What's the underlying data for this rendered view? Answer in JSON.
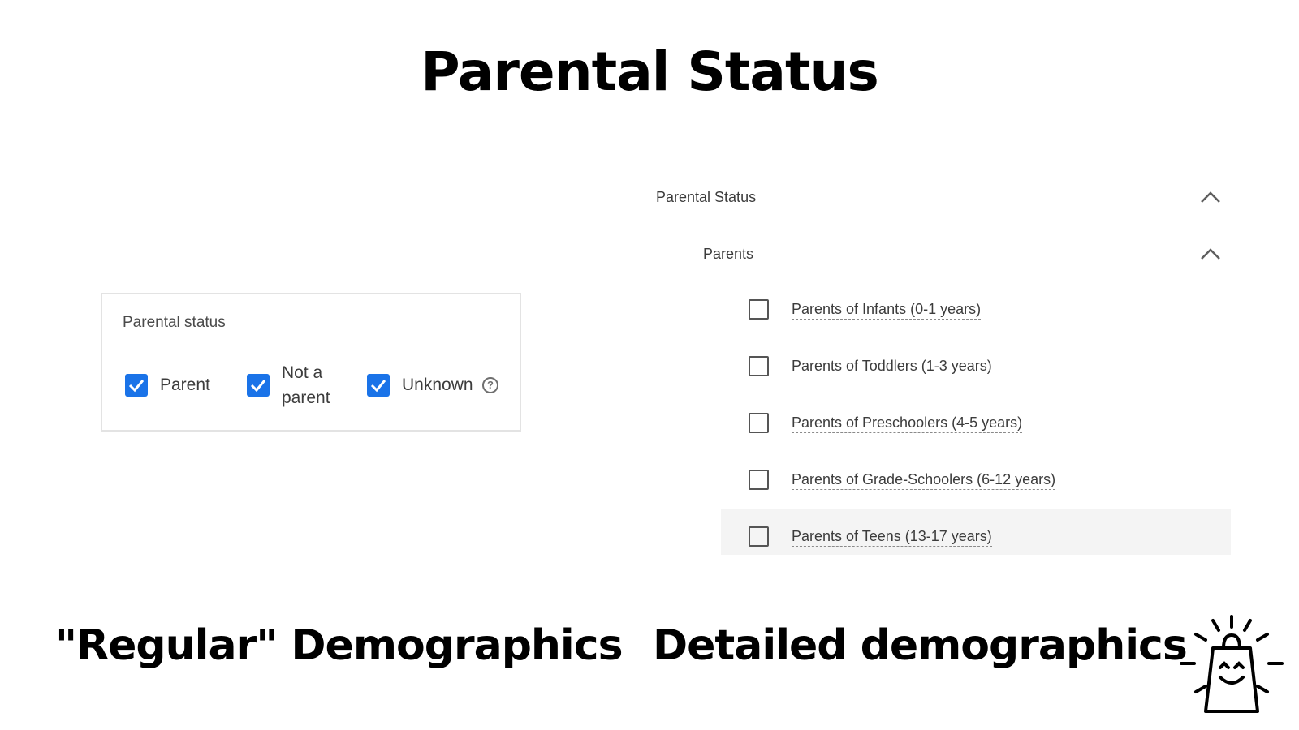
{
  "page": {
    "title": "Parental Status"
  },
  "regular": {
    "panel_title": "Parental status",
    "options": [
      {
        "label": "Parent",
        "checked": true
      },
      {
        "label": "Not a\nparent",
        "checked": true
      },
      {
        "label": "Unknown",
        "checked": true
      }
    ],
    "caption": "\"Regular\" Demographics"
  },
  "detailed": {
    "header": "Parental Status",
    "subheader": "Parents",
    "items": [
      {
        "label": "Parents of Infants (0-1 years)",
        "checked": false
      },
      {
        "label": "Parents of Toddlers (1-3 years)",
        "checked": false
      },
      {
        "label": "Parents of Preschoolers (4-5 years)",
        "checked": false
      },
      {
        "label": "Parents of Grade-Schoolers (6-12 years)",
        "checked": false
      },
      {
        "label": "Parents of Teens (13-17 years)",
        "checked": false
      }
    ],
    "caption": "Detailed demographics"
  },
  "colors": {
    "checkbox_checked": "#1a73e8",
    "hover_row": "#f4f4f4"
  },
  "icons": [
    "checkmark-icon",
    "help-icon",
    "chevron-up-icon",
    "shopping-bag-logo-icon"
  ]
}
